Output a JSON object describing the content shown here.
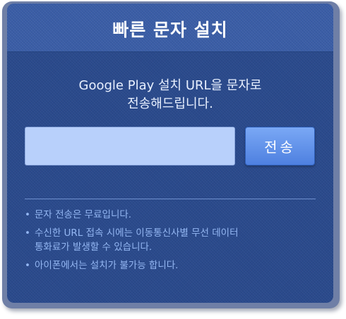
{
  "header": {
    "title": "빠른 문자 설치"
  },
  "intro": {
    "line1": "Google Play 설치 URL을 문자로",
    "line2": "전송해드립니다."
  },
  "form": {
    "phone_value": "",
    "send_label": "전송"
  },
  "notes": [
    {
      "line1": "문자 전송은 무료입니다.",
      "line2": ""
    },
    {
      "line1": "수신한 URL 접속 시에는 이동통신사별 무선 데이터",
      "line2": "통화료가 발생할 수 있습니다."
    },
    {
      "line1": "아이폰에서는 설치가 불가능 합니다.",
      "line2": ""
    }
  ],
  "colors": {
    "panel_bg": "#2a4a8c",
    "header_bg": "#3a5da6",
    "input_bg": "#b8d0fb",
    "button_bg": "#5f90ea",
    "note_text": "#93b6f2"
  }
}
